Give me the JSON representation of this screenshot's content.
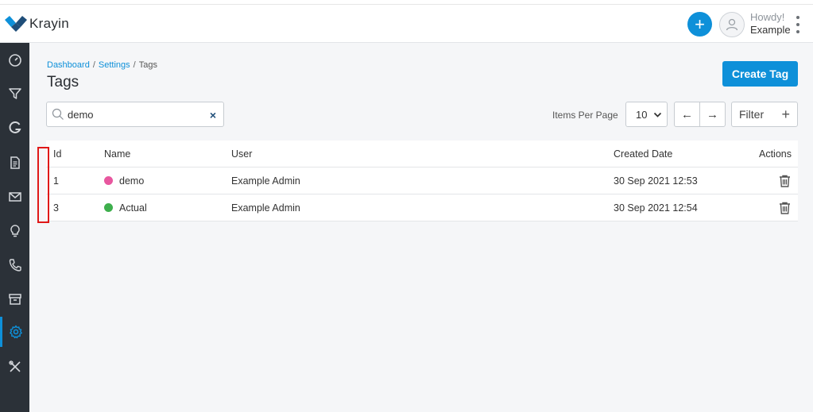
{
  "header": {
    "app_name": "Krayin",
    "greeting": "Howdy!",
    "user_name": "Example",
    "add_symbol": "+"
  },
  "sidebar": {
    "items": [
      {
        "icon": "dashboard-icon"
      },
      {
        "icon": "filter-icon"
      },
      {
        "icon": "leads-g-icon"
      },
      {
        "icon": "document-icon"
      },
      {
        "icon": "mail-icon"
      },
      {
        "icon": "lightbulb-icon"
      },
      {
        "icon": "phone-icon"
      },
      {
        "icon": "archive-icon"
      },
      {
        "icon": "settings-gear-icon",
        "active": true
      },
      {
        "icon": "tools-icon"
      }
    ]
  },
  "breadcrumb": {
    "dashboard": "Dashboard",
    "settings": "Settings",
    "current": "Tags",
    "separator": "/"
  },
  "page": {
    "title": "Tags",
    "create_button": "Create Tag"
  },
  "toolbar": {
    "search_value": "demo",
    "clear_symbol": "×",
    "items_per_page_label": "Items Per Page",
    "items_per_page_value": "10",
    "prev_symbol": "←",
    "next_symbol": "→",
    "filter_label": "Filter",
    "filter_plus": "+"
  },
  "table": {
    "headers": {
      "id": "Id",
      "name": "Name",
      "user": "User",
      "created": "Created Date",
      "actions": "Actions"
    },
    "rows": [
      {
        "id": "1",
        "name": "demo",
        "color": "#e8579f",
        "user": "Example Admin",
        "created": "30 Sep 2021 12:53"
      },
      {
        "id": "3",
        "name": "Actual",
        "color": "#3eaf4d",
        "user": "Example Admin",
        "created": "30 Sep 2021 12:54"
      }
    ]
  },
  "colors": {
    "accent": "#0e90d9",
    "sidebar": "#2b3138",
    "highlight": "#e01818"
  }
}
